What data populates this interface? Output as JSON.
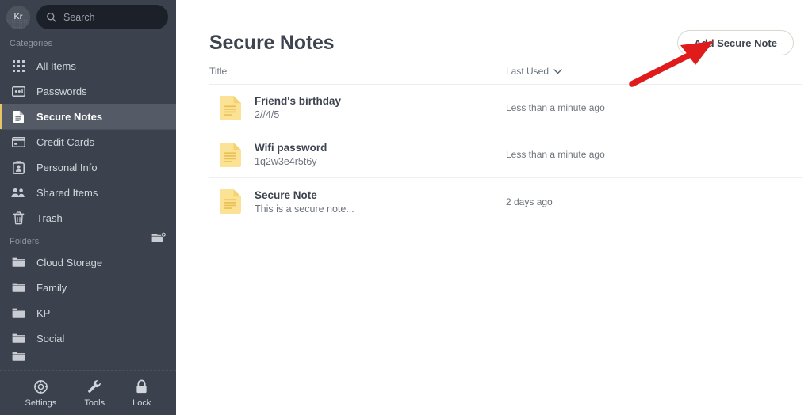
{
  "sidebar": {
    "avatar_initials": "Kr",
    "search": {
      "icon": "search-icon",
      "placeholder": "Search",
      "value": ""
    },
    "categories_label": "Categories",
    "categories": [
      {
        "label": "All Items",
        "icon": "grid-icon",
        "active": false
      },
      {
        "label": "Passwords",
        "icon": "password-icon",
        "active": false
      },
      {
        "label": "Secure Notes",
        "icon": "note-icon",
        "active": true
      },
      {
        "label": "Credit Cards",
        "icon": "credit-card-icon",
        "active": false
      },
      {
        "label": "Personal Info",
        "icon": "id-card-icon",
        "active": false
      },
      {
        "label": "Shared Items",
        "icon": "people-icon",
        "active": false
      },
      {
        "label": "Trash",
        "icon": "trash-icon",
        "active": false
      }
    ],
    "folders_label": "Folders",
    "add_folder_icon": "add-folder-icon",
    "folders": [
      {
        "label": "Cloud Storage",
        "icon": "folder-icon"
      },
      {
        "label": "Family",
        "icon": "folder-icon"
      },
      {
        "label": "KP",
        "icon": "folder-icon"
      },
      {
        "label": "Social",
        "icon": "folder-icon"
      }
    ],
    "bottom_bar": [
      {
        "label": "Settings",
        "icon": "gear-icon"
      },
      {
        "label": "Tools",
        "icon": "wrench-icon"
      },
      {
        "label": "Lock",
        "icon": "lock-icon"
      }
    ]
  },
  "main": {
    "title": "Secure Notes",
    "add_button_label": "Add Secure Note",
    "columns": {
      "title": "Title",
      "last_used": "Last Used",
      "sort_icon": "chevron-down-icon"
    },
    "notes": [
      {
        "icon": "yellow-note-icon",
        "title": "Friend's birthday",
        "subtitle": "2//4/5",
        "last_used": "Less than a minute ago"
      },
      {
        "icon": "yellow-note-icon",
        "title": "Wifi password",
        "subtitle": "1q2w3e4r5t6y",
        "last_used": "Less than a minute ago"
      },
      {
        "icon": "yellow-note-icon",
        "title": "Secure Note",
        "subtitle": "This is a secure note...",
        "last_used": "2 days ago"
      }
    ]
  },
  "annotation": {
    "type": "red-arrow",
    "color": "#e01b1b",
    "points_to": "Add Secure Note"
  },
  "colors": {
    "sidebar_bg": "#3c424d",
    "sidebar_active_bg": "#555b66",
    "sidebar_active_accent": "#e8c667",
    "search_bg": "#1c2029",
    "note_yellow": "#fbe294",
    "text_dark": "#3d4450",
    "text_muted": "#6d737d"
  }
}
